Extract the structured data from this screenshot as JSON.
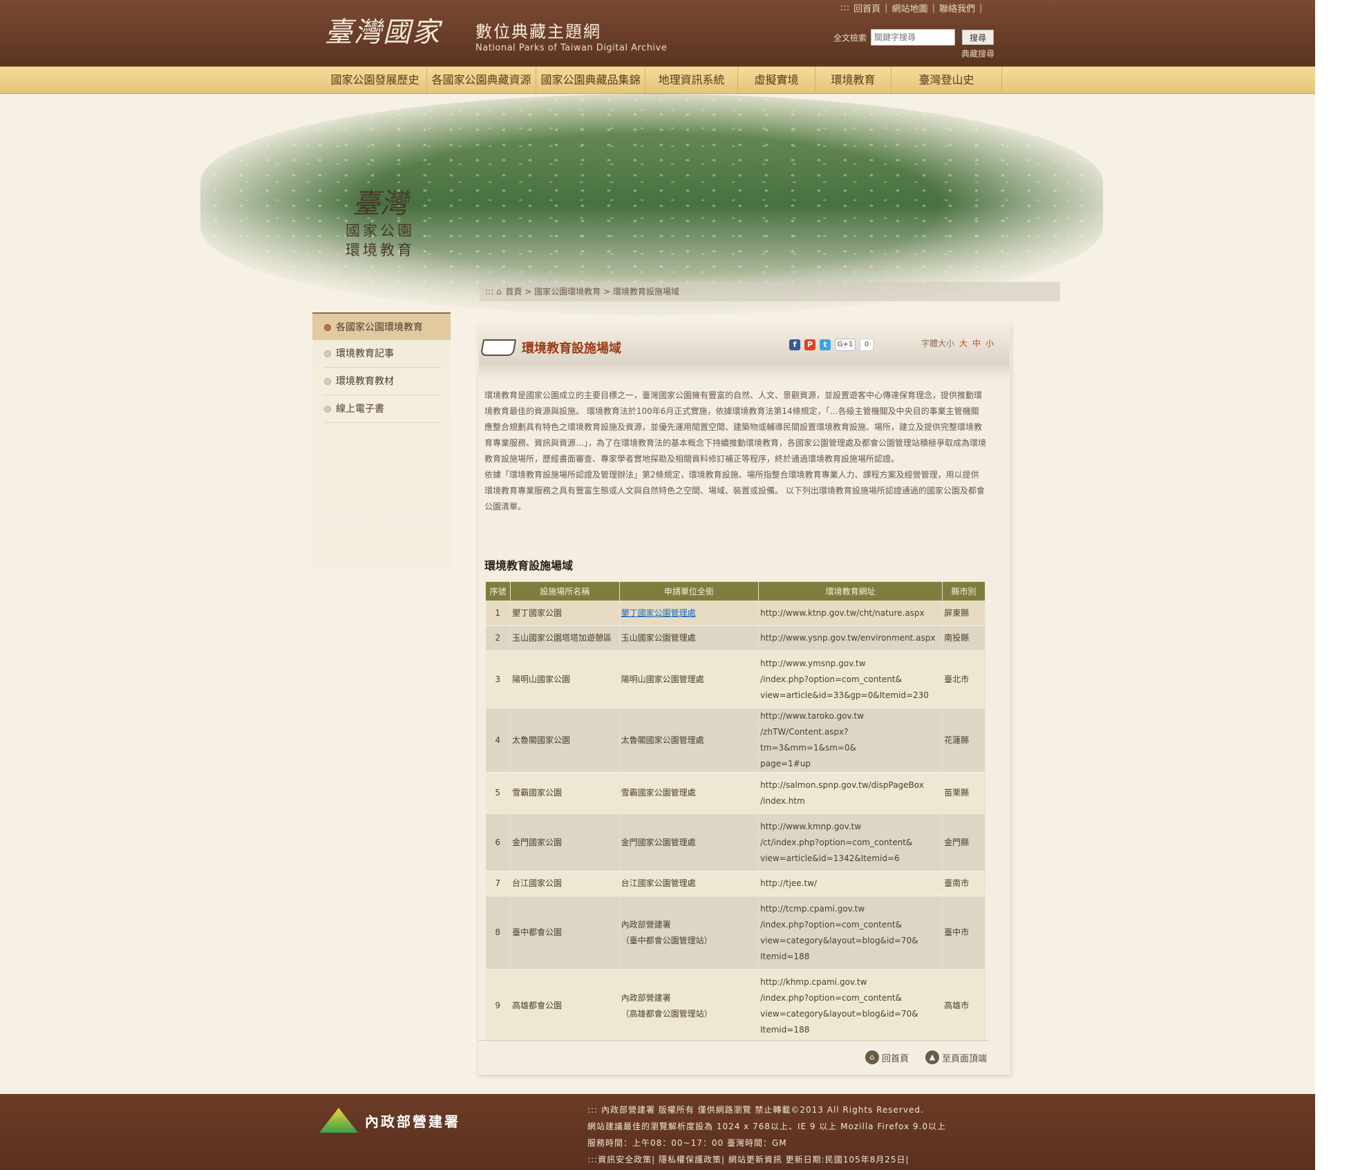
{
  "header": {
    "logo_text": "臺灣國家公園",
    "site_title": "數位典藏主題網",
    "site_subtitle": "National Parks of Taiwan Digital Archive",
    "top_links": [
      ":::",
      "回首頁",
      "網站地圖",
      "聯絡我們"
    ],
    "search_label": "全文檢索",
    "search_placeholder": "關鍵字搜尋",
    "search_button": "搜尋",
    "advanced_search": "典藏搜尋"
  },
  "nav": {
    "items": [
      "國家公園發展歷史",
      "各國家公園典藏資源",
      "國家公園典藏品集錦",
      "地理資訊系統",
      "虛擬實境",
      "環境教育",
      "臺灣登山史"
    ]
  },
  "banner": {
    "badge_big": "臺灣",
    "badge_line1": "國家公園",
    "badge_line2": "環境教育"
  },
  "breadcrumb": {
    "prefix": ":::",
    "items": [
      "首頁",
      ">",
      "國家公園環境教育",
      ">",
      "環境教育設施場域"
    ]
  },
  "sidebar": {
    "items": [
      "各國家公園環境教育",
      "環境教育記事",
      "環境教育教材",
      "線上電子書"
    ]
  },
  "main": {
    "heading": "環境教育設施場域",
    "share": {
      "gplus": "G+1",
      "gplus_count": "0"
    },
    "fontsize": {
      "label": "字體大小",
      "large": "大",
      "medium": "中",
      "small": "小"
    },
    "intro_p1": "環境教育是國家公園成立的主要目標之一，臺灣國家公園擁有豐富的自然、人文、景觀資源，並設置遊客中心傳達保育理念，提供推動環境教育最佳的資源與設施。 環境教育法於100年6月正式實施，依據環境教育法第14條規定，「…各級主管機關及中央目的事業主管機關應整合規劃具有特色之環境教育設施及資源，並優先運用閒置空間、建築物或輔導民間設置環境教育設施、場所，建立及提供完整環境教育專業服務、資訊與資源…」，為了在環境教育法的基本概念下持續推動環境教育，各國家公園管理處及都會公園管理站積極爭取成為環境教育設施場所，歷經書面審查、專家學者實地探勘及相關資料修訂補正等程序，終於通過環境教育設施場所認證。",
    "intro_p2": "依據「環境教育設施場所認證及管理辦法」第2條規定，環境教育設施、場所指整合環境教育專業人力、課程方案及經營管理，用以提供環境教育專業服務之具有豐富生態或人文與自然特色之空間、場域、裝置或設備。 以下列出環境教育設施場所認證通過的國家公園及都會公園清單。",
    "section_title": "環境教育設施場域",
    "table": {
      "headers": [
        "序號",
        "設施場所名稱",
        "申請單位全銜",
        "環境教育網址",
        "縣市別"
      ],
      "rows": [
        {
          "no": "1",
          "name": "墾丁國家公園",
          "org": "墾丁國家公園管理處",
          "url": "http://www.ktnp.gov.tw/cht/nature.aspx",
          "city": "屏東縣"
        },
        {
          "no": "2",
          "name": "玉山國家公園塔塔加遊憩區",
          "org": "玉山國家公園管理處",
          "url": "http://www.ysnp.gov.tw/environment.aspx",
          "city": "南投縣"
        },
        {
          "no": "3",
          "name": "陽明山國家公園",
          "org": "陽明山國家公園管理處",
          "url": "http://www.ymsnp.gov.tw/index.php?option=com_content&view=article&id=33&gp=0&Itemid=230",
          "city": "臺北市"
        },
        {
          "no": "4",
          "name": "太魯閣國家公園",
          "org": "太魯閣國家公園管理處",
          "url": "http://www.taroko.gov.tw/zhTW/Content.aspx?tm=3&mm=1&sm=0&page=1#up",
          "city": "花蓮縣"
        },
        {
          "no": "5",
          "name": "雪霸國家公園",
          "org": "雪霸國家公園管理處",
          "url": "http://salmon.spnp.gov.tw/dispPageBox/index.htm",
          "city": "苗栗縣"
        },
        {
          "no": "6",
          "name": "金門國家公園",
          "org": "金門國家公園管理處",
          "url": "http://www.kmnp.gov.tw/ct/index.php?option=com_content&view=article&id=1342&Itemid=6",
          "city": "金門縣"
        },
        {
          "no": "7",
          "name": "台江國家公園",
          "org": "台江國家公園管理處",
          "url": "http://tjee.tw/",
          "city": "臺南市"
        },
        {
          "no": "8",
          "name": "臺中都會公園",
          "org": "內政部營建署（臺中都會公園管理站）",
          "url": "http://tcmp.cpami.gov.tw/index.php?option=com_content&view=category&layout=blog&id=70&Itemid=188",
          "city": "臺中市"
        },
        {
          "no": "9",
          "name": "高雄都會公園",
          "org": "內政部營建署（高雄都會公園管理站）",
          "url": "http://khmp.cpami.gov.tw/index.php?option=com_content&view=category&layout=blog&id=70&Itemid=188",
          "city": "高雄市"
        }
      ],
      "rows_display": {
        "r1_url": "http://www.ktnp.gov.tw/cht/nature.aspx",
        "r2_url": "http://www.ysnp.gov.tw/environment.aspx",
        "r3_url_l1": "http://www.ymsnp.gov.tw",
        "r3_url_l2": "/index.php?option=com_content&",
        "r3_url_l3": "view=article&id=33&gp=0&Itemid=230",
        "r4_url_l1": "http://www.taroko.gov.tw",
        "r4_url_l2": "/zhTW/Content.aspx?tm=3&mm=1&sm=0&",
        "r4_url_l3": "page=1#up",
        "r5_url_l1": "http://salmon.spnp.gov.tw/dispPageBox",
        "r5_url_l2": "/index.htm",
        "r6_url_l1": "http://www.kmnp.gov.tw",
        "r6_url_l2": "/ct/index.php?option=com_content&",
        "r6_url_l3": "view=article&id=1342&Itemid=6",
        "r7_url": "http://tjee.tw/",
        "r8_org_l1": "內政部營建署",
        "r8_org_l2": "（臺中都會公園管理站）",
        "r8_url_l1": "http://tcmp.cpami.gov.tw",
        "r8_url_l2": "/index.php?option=com_content&",
        "r8_url_l3": "view=category&layout=blog&id=70&",
        "r8_url_l4": "Itemid=188",
        "r9_org_l1": "內政部營建署",
        "r9_org_l2": "（高雄都會公園管理站）",
        "r9_url_l1": "http://khmp.cpami.gov.tw",
        "r9_url_l2": "/index.php?option=com_content&",
        "r9_url_l3": "view=category&layout=blog&id=70&",
        "r9_url_l4": "Itemid=188"
      }
    },
    "bottom_links": {
      "back": "回首頁",
      "top": "至頁面頂端"
    }
  },
  "footer": {
    "logo_text": "內政部營建署",
    "line1": "::: 內政部營建署 版權所有 僅供網路瀏覽 禁止轉載©2013 All Rights Reserved.",
    "line2": "網站建議最佳的瀏覽解析度設為 1024 x 768以上、IE 9 以上 Mozilla Firefox 9.0以上",
    "line3": "服務時間：上午08：00~17：00 臺灣時間：GM",
    "line4": ":::資訊安全政策| 隱私權保護政策| 網站更新資訊 更新日期:民國105年8月25日|"
  }
}
